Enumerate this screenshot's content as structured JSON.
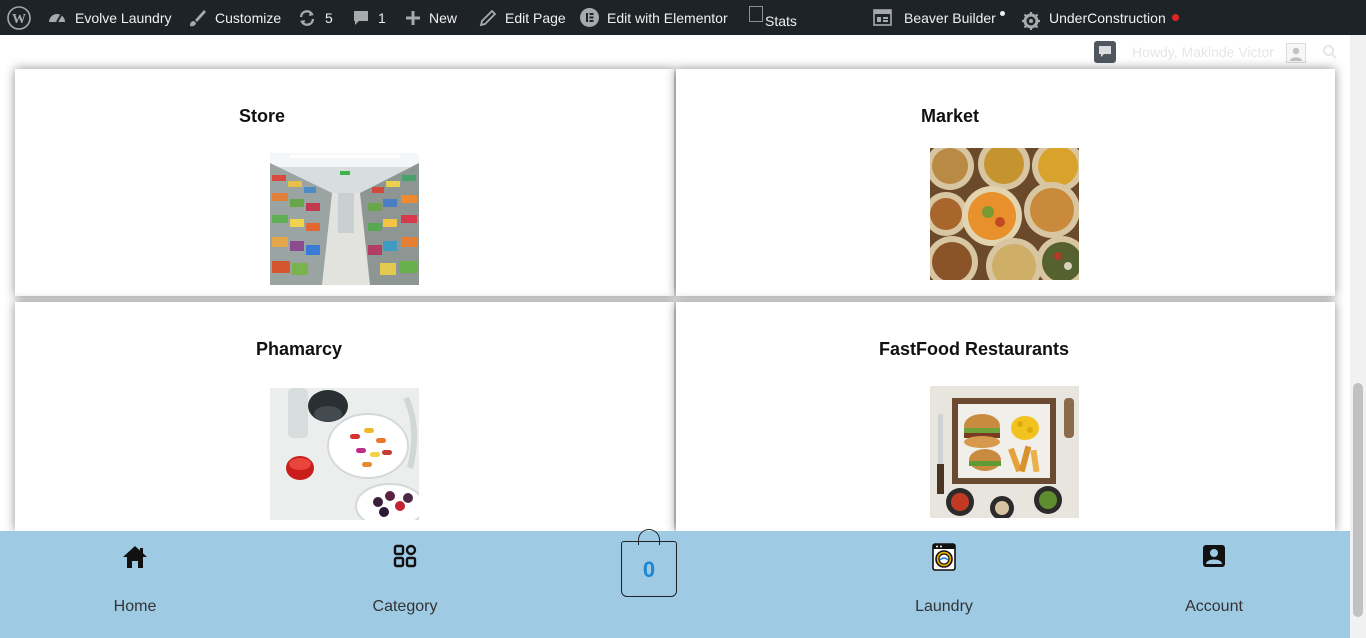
{
  "adminbar": {
    "site_name": "Evolve Laundry",
    "customize": "Customize",
    "updates_count": "5",
    "comments_count": "1",
    "new": "New",
    "edit_page": "Edit Page",
    "edit_elementor": "Edit with Elementor",
    "stats_alt": "Stats",
    "beaver_builder": "Beaver Builder",
    "under_construction": "UnderConstruction",
    "howdy": "Howdy, Makinde Victor"
  },
  "cards": [
    {
      "title": "Store",
      "image": "supermarket-aisle-photo"
    },
    {
      "title": "Market",
      "image": "market-spices-photo"
    },
    {
      "title": "Phamarcy",
      "image": "pills-on-plates-photo"
    },
    {
      "title": "FastFood Restaurants",
      "image": "burger-and-fries-photo"
    }
  ],
  "bottom_nav": {
    "items": [
      {
        "label": "Home",
        "icon": "home-icon"
      },
      {
        "label": "Category",
        "icon": "grid-icon"
      },
      {
        "label": "Laundry",
        "icon": "washing-machine-icon"
      },
      {
        "label": "Account",
        "icon": "account-icon"
      }
    ],
    "cart_count": "0"
  },
  "colors": {
    "adminbar_bg": "#1d2327",
    "bottom_nav_bg": "#9fcae4",
    "cart_count": "#1e86d1",
    "under_construction_dot": "#e02424"
  }
}
